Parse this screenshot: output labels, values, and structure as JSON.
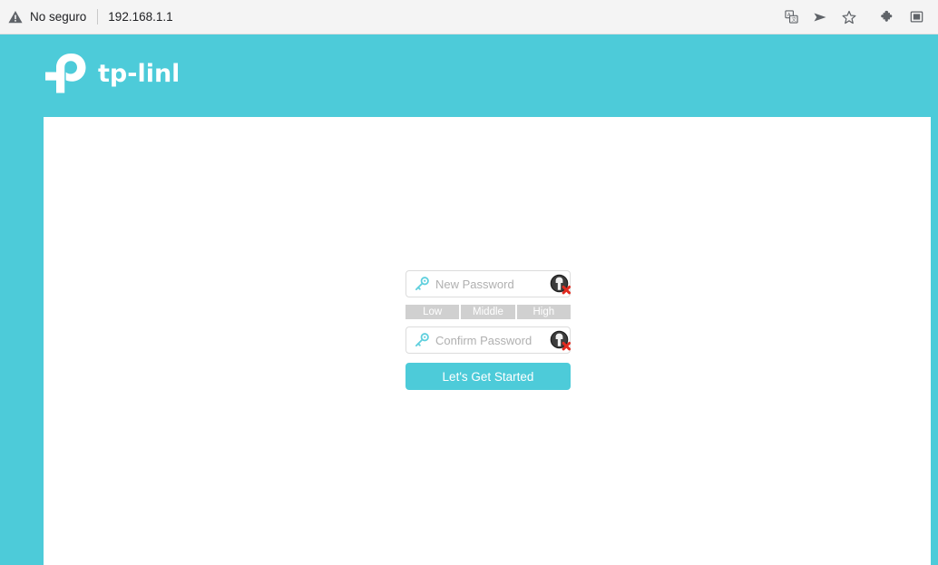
{
  "browser": {
    "security_label": "No seguro",
    "url": "192.168.1.1",
    "warning_icon": "warning-triangle-icon",
    "actions": [
      {
        "name": "translate-icon",
        "title": "Translate"
      },
      {
        "name": "share-icon",
        "title": "Share"
      },
      {
        "name": "bookmark-star-icon",
        "title": "Bookmark"
      },
      {
        "name": "extensions-puzzle-icon",
        "title": "Extensions"
      },
      {
        "name": "sidebar-panel-icon",
        "title": "Side panel"
      }
    ]
  },
  "brand": {
    "name": "tp-link",
    "logo_icon": "tp-link-logo"
  },
  "theme": {
    "accent": "#4dcbd9",
    "page_background": "#ffffff",
    "meter_segment": "#d0d0d0",
    "placeholder": "#b0b0b0",
    "broken_image_x": "#e02b20"
  },
  "form": {
    "new_password": {
      "placeholder": "New Password",
      "value": "",
      "icon": "key-icon",
      "toggle_icon": "broken-image-icon"
    },
    "confirm_password": {
      "placeholder": "Confirm Password",
      "value": "",
      "icon": "key-icon",
      "toggle_icon": "broken-image-icon"
    },
    "strength_meter": {
      "segments": [
        "Low",
        "Middle",
        "High"
      ]
    },
    "submit_label": "Let's Get Started"
  }
}
